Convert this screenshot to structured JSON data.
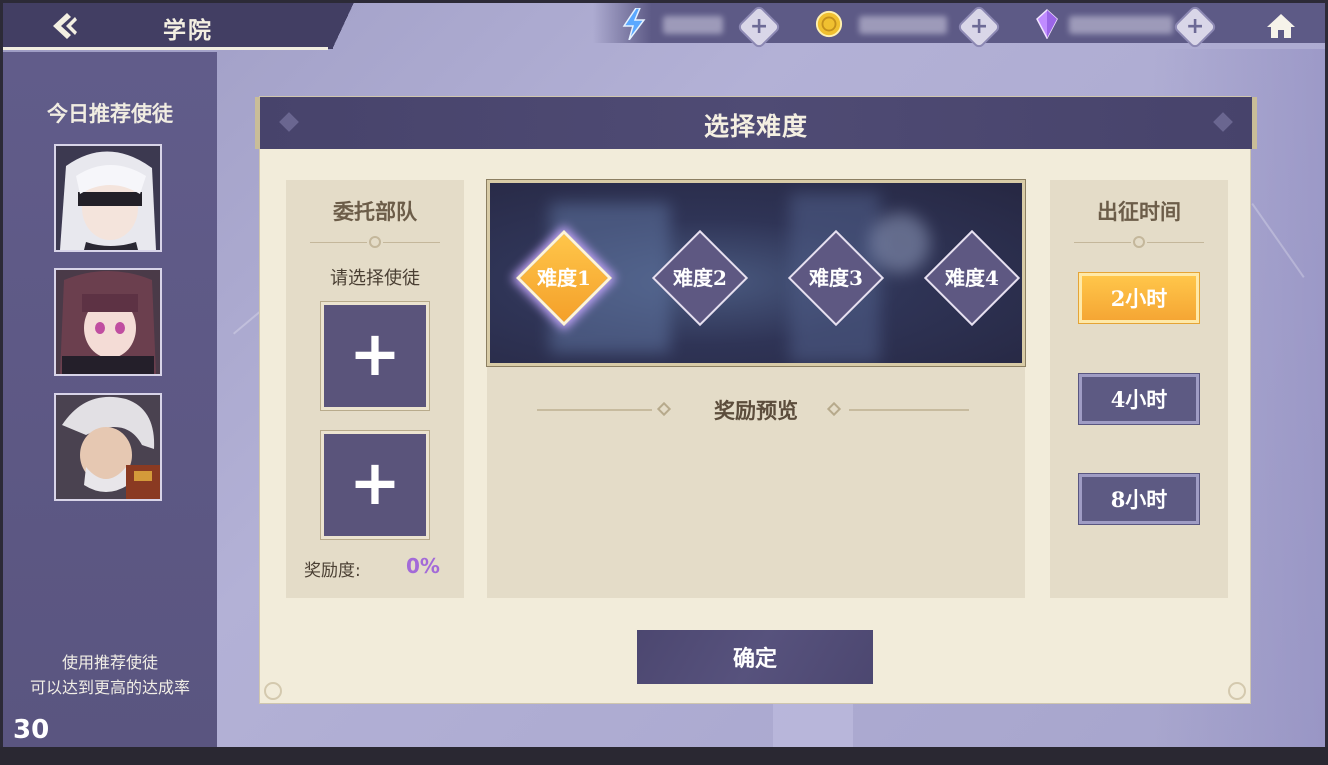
{
  "header": {
    "title": "学院",
    "resources": [
      {
        "icon": "energy-icon",
        "color": "#5aa8ff"
      },
      {
        "icon": "gold-coin-icon",
        "color": "#f0c030"
      },
      {
        "icon": "crystal-icon",
        "color": "#c08cff"
      }
    ]
  },
  "sidebar": {
    "title": "今日推荐使徒",
    "portraits": [
      "portrait-white-hair-blindfold",
      "portrait-dark-hair-girl",
      "portrait-silver-hair-warrior"
    ],
    "tip_line1": "使用推荐使徒",
    "tip_line2": "可以达到更高的达成率",
    "counter": "30"
  },
  "panel": {
    "title": "选择难度",
    "team": {
      "title": "委托部队",
      "subtitle": "请选择使徒",
      "slot_symbol": "+",
      "reward_label": "奖励度:",
      "reward_value": "0%"
    },
    "difficulties": [
      {
        "label": "难度1",
        "selected": true
      },
      {
        "label": "难度2",
        "selected": false
      },
      {
        "label": "难度3",
        "selected": false
      },
      {
        "label": "难度4",
        "selected": false
      }
    ],
    "reward_preview": "奖励预览",
    "time": {
      "title": "出征时间",
      "options": [
        {
          "label": "2小时",
          "selected": true
        },
        {
          "label": "4小时",
          "selected": false
        },
        {
          "label": "8小时",
          "selected": false
        }
      ]
    },
    "confirm_label": "确定"
  },
  "colors": {
    "accent_orange": "#f5a634",
    "panel_purple": "#47436b",
    "reward_purple": "#a36ad8"
  }
}
